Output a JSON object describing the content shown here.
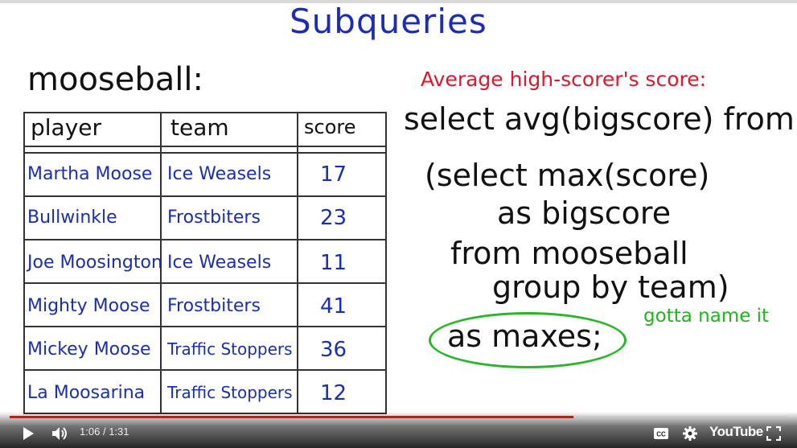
{
  "slide": {
    "title": "Subqueries",
    "table_name": "mooseball:",
    "note_red": "Average high-scorer's score:",
    "sql_lines": [
      "select avg(bigscore) from",
      "(select max(score)",
      "as bigscore",
      "from mooseball",
      "group by team)",
      "as maxes;"
    ],
    "note_green": "gotta name it"
  },
  "table": {
    "headers": [
      "player",
      "team",
      "score"
    ],
    "rows": [
      {
        "player": "Martha Moose",
        "team": "Ice Weasels",
        "score": "17"
      },
      {
        "player": "Bullwinkle",
        "team": "Frostbiters",
        "score": "23"
      },
      {
        "player": "Joe Moosington",
        "team": "Ice Weasels",
        "score": "11"
      },
      {
        "player": "Mighty Moose",
        "team": "Frostbiters",
        "score": "41"
      },
      {
        "player": "Mickey Moose",
        "team": "Traffic Stoppers",
        "score": "36"
      },
      {
        "player": "La Moosarina",
        "team": "Traffic Stoppers",
        "score": "12"
      }
    ]
  },
  "player": {
    "current_time": "1:06",
    "separator": "/",
    "duration": "1:31",
    "progress": 0.725,
    "brand": "YouTube",
    "icons": [
      "play-icon",
      "volume-icon",
      "captions-icon",
      "settings-icon",
      "fullscreen-icon"
    ],
    "accent_color": "#ff0000"
  }
}
